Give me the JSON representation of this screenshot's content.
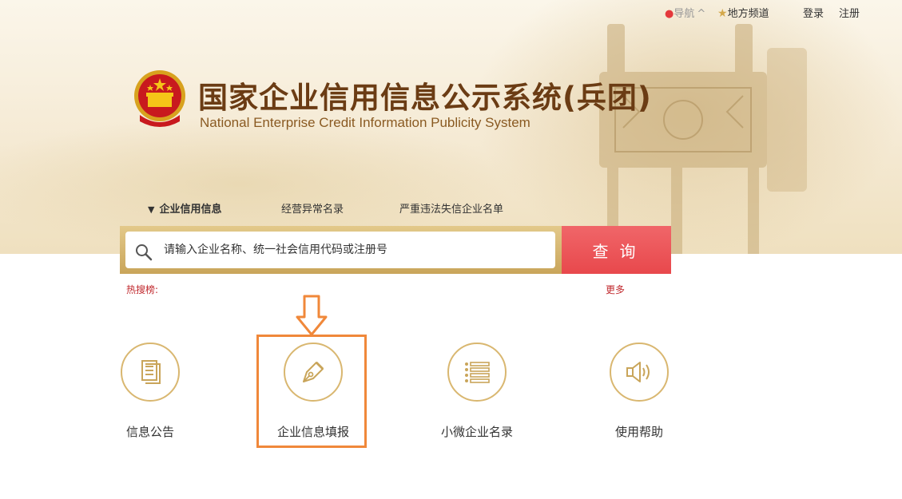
{
  "topbar": {
    "nav_label": "导航",
    "nav_caret": "^",
    "local_channel": "地方频道",
    "login": "登录",
    "register": "注册"
  },
  "brand": {
    "title_cn": "国家企业信用信息公示系统(兵团)",
    "title_en": "National Enterprise Credit Information Publicity System"
  },
  "search": {
    "tabs": [
      {
        "label": "企业信用信息",
        "active": true
      },
      {
        "label": "经营异常名录",
        "active": false
      },
      {
        "label": "严重违法失信企业名单",
        "active": false
      }
    ],
    "placeholder": "请输入企业名称、统一社会信用代码或注册号",
    "button_label": "查询",
    "hot_label": "热搜榜:",
    "more_label": "更多"
  },
  "features": [
    {
      "label": "信息公告",
      "icon": "document-icon"
    },
    {
      "label": "企业信息填报",
      "icon": "pen-nib-icon"
    },
    {
      "label": "小微企业名录",
      "icon": "list-icon"
    },
    {
      "label": "使用帮助",
      "icon": "speaker-icon"
    }
  ],
  "colors": {
    "accent_red": "#e8484c",
    "gold": "#d9b770",
    "brand_brown": "#6b3c14",
    "highlight_orange": "#f0883a",
    "hot_red": "#c0282d"
  }
}
